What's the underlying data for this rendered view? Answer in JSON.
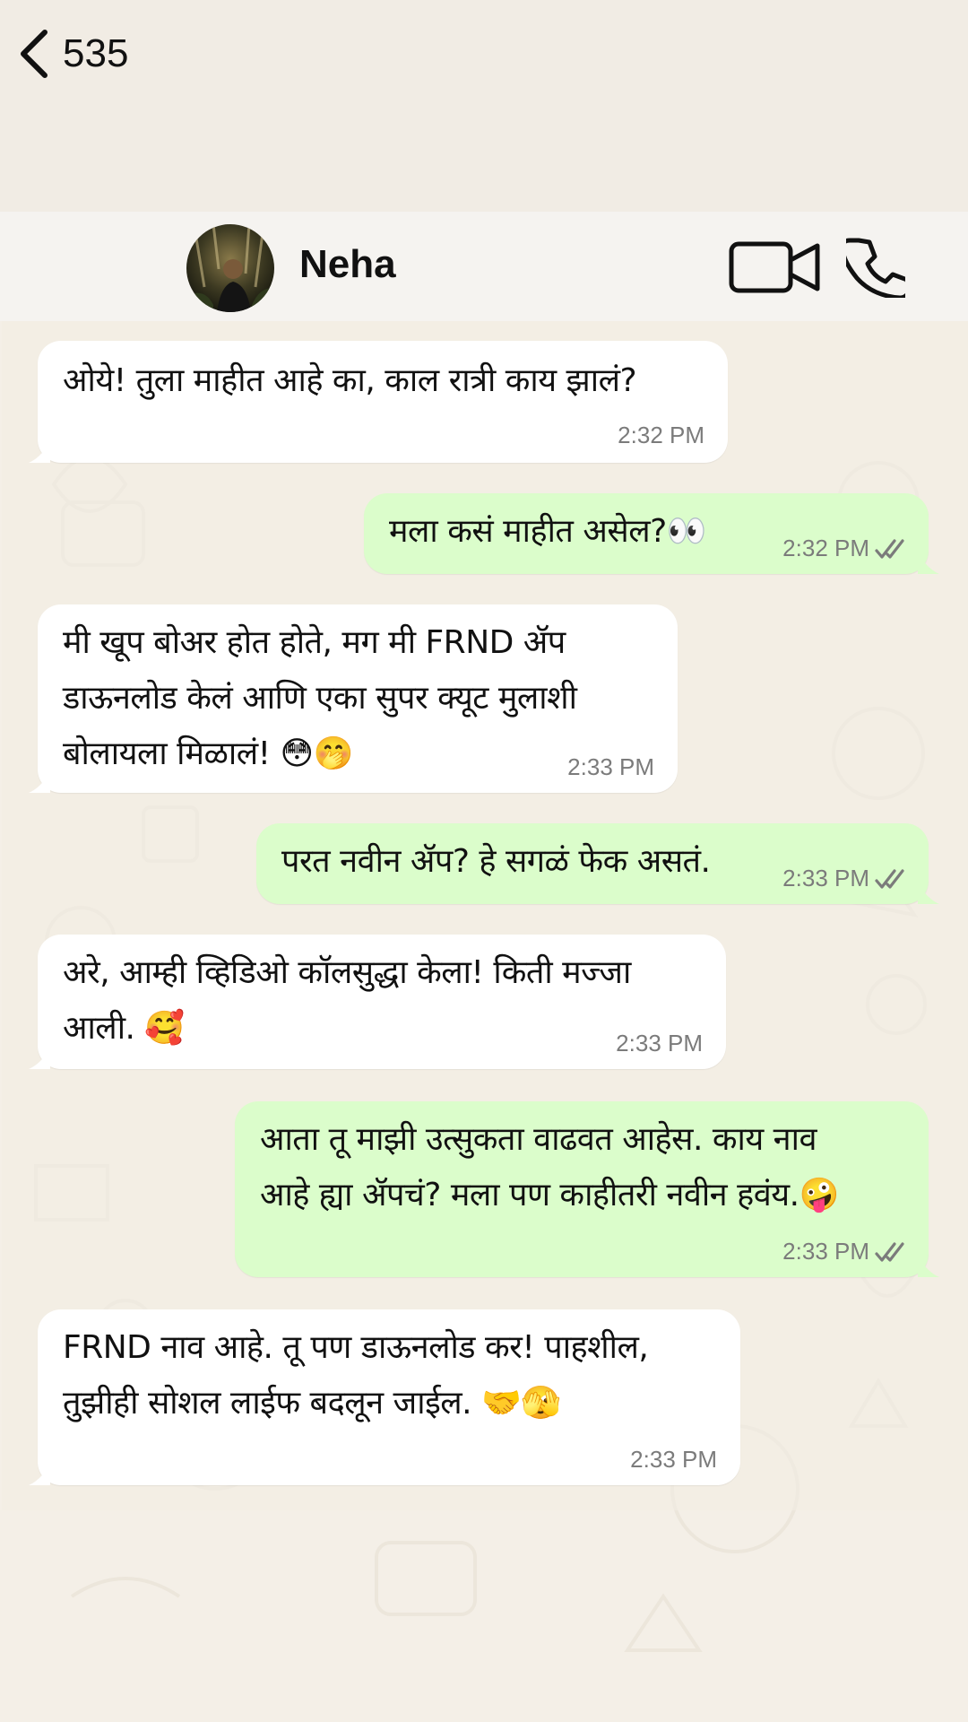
{
  "header": {
    "back_count": "535",
    "contact_name": "Neha"
  },
  "messages": [
    {
      "direction": "in",
      "lines": [
        "ओये! तुला माहीत आहे का, काल रात्री काय झालं?"
      ],
      "time": "2:32 PM"
    },
    {
      "direction": "out",
      "lines": [
        "मला कसं माहीत असेल?👀"
      ],
      "time": "2:32 PM",
      "status": "read"
    },
    {
      "direction": "in",
      "lines": [
        "मी खूप बोअर होत होते, मग मी FRND ॲप",
        "डाऊनलोड केलं आणि एका सुपर क्यूट मुलाशी",
        "बोलायला मिळालं! 😳🤭"
      ],
      "time": "2:33 PM"
    },
    {
      "direction": "out",
      "lines": [
        "परत नवीन ॲप? हे सगळं फेक असतं."
      ],
      "time": "2:33 PM",
      "status": "read"
    },
    {
      "direction": "in",
      "lines": [
        "अरे, आम्ही व्हिडिओ कॉलसुद्धा केला! किती मज्जा",
        "आली. 🥰"
      ],
      "time": "2:33 PM"
    },
    {
      "direction": "out",
      "lines": [
        "आता तू माझी उत्सुकता वाढवत आहेस. काय नाव",
        "आहे ह्या ॲपचं? मला पण काहीतरी नवीन हवंय.🤪"
      ],
      "time": "2:33 PM",
      "status": "read"
    },
    {
      "direction": "in",
      "lines": [
        "FRND नाव आहे. तू पण डाऊनलोड कर! पाहशील,",
        "तुझीही सोशल लाईफ बदलून जाईल. 🤝🫣"
      ],
      "time": "2:33 PM"
    }
  ],
  "colors": {
    "incoming_bubble": "#ffffff",
    "outgoing_bubble": "#dbfdcb",
    "header_bg": "#f5f3f0",
    "chat_bg": "#f4efe7"
  },
  "icons": {
    "back": "chevron-left-icon",
    "video": "video-camera-icon",
    "call": "phone-icon",
    "read": "double-check-icon"
  }
}
